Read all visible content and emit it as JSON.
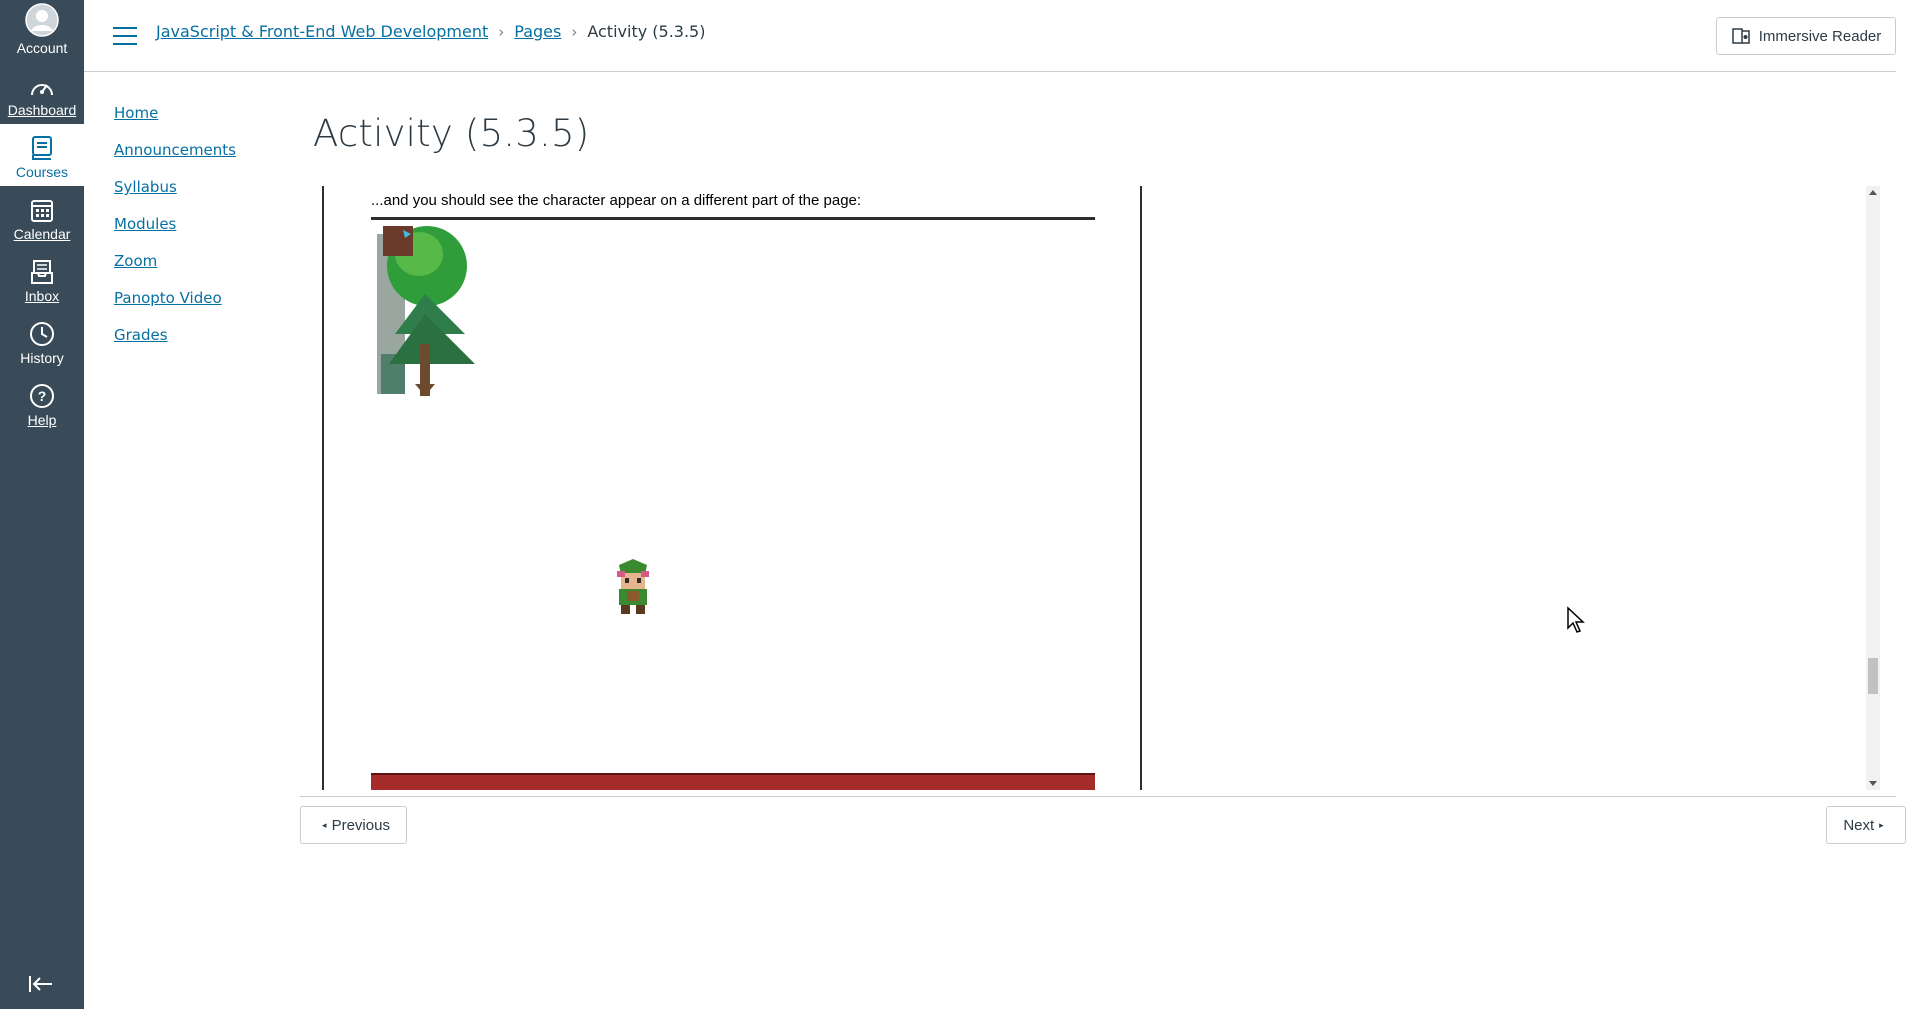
{
  "global_nav": {
    "items": [
      {
        "label": "Account",
        "icon": "account-avatar-icon"
      },
      {
        "label": "Dashboard",
        "icon": "dashboard-gauge-icon"
      },
      {
        "label": "Courses",
        "icon": "courses-book-icon"
      },
      {
        "label": "Calendar",
        "icon": "calendar-icon"
      },
      {
        "label": "Inbox",
        "icon": "inbox-icon"
      },
      {
        "label": "History",
        "icon": "history-clock-icon"
      },
      {
        "label": "Help",
        "icon": "help-question-icon"
      }
    ],
    "active": "Courses",
    "bg_color": "#394b58"
  },
  "header": {
    "breadcrumb": [
      "JavaScript & Front-End Web Development",
      "Pages",
      "Activity (5.3.5)"
    ],
    "immersive_reader_label": "Immersive Reader"
  },
  "course_nav": [
    "Home",
    "Announcements",
    "Syllabus",
    "Modules",
    "Zoom",
    "Panopto Video",
    "Grades"
  ],
  "page": {
    "title": "Activity (5.3.5)",
    "instruction": "...and you should see the character appear on a different part of the page:"
  },
  "pager": {
    "previous_label": "Previous",
    "next_label": "Next"
  },
  "colors": {
    "link": "#0770a3",
    "text": "#2d3b45",
    "red_bar": "#a62c2b"
  }
}
